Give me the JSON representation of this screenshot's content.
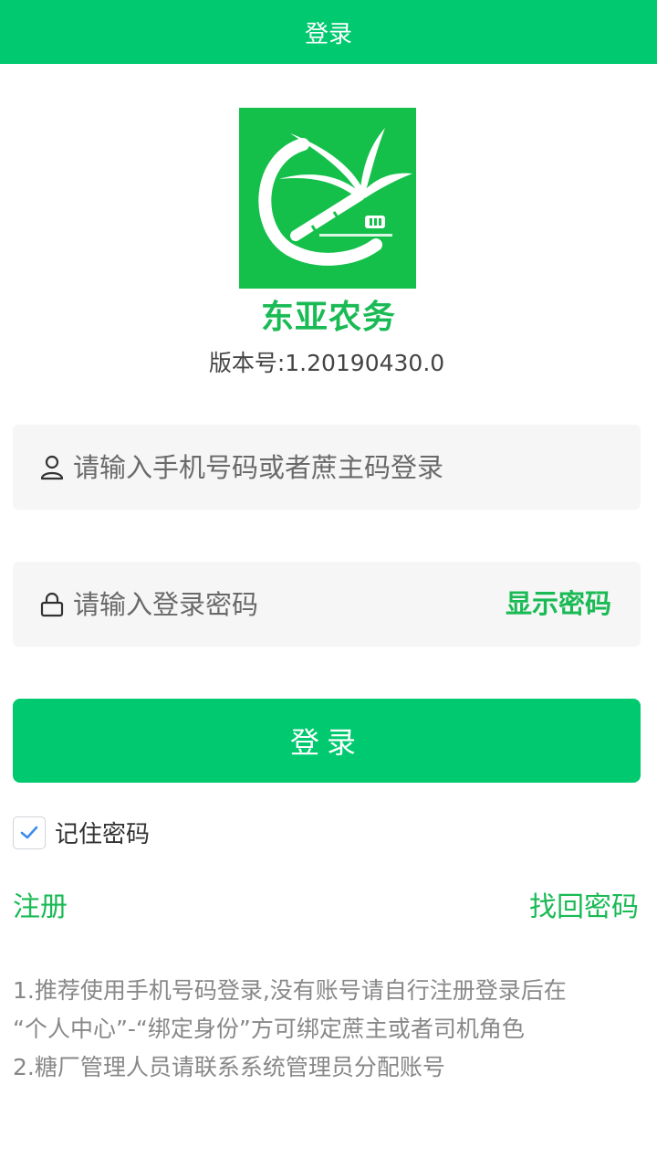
{
  "header": {
    "title": "登录"
  },
  "app": {
    "name": "东亚农务",
    "version": "版本号:1.20190430.0"
  },
  "form": {
    "account_placeholder": "请输入手机号码或者蔗主码登录",
    "password_placeholder": "请输入登录密码",
    "show_password_label": "显示密码",
    "login_label": "登录",
    "remember_label": "记住密码",
    "remember_checked": true
  },
  "links": {
    "register": "注册",
    "forgot_password": "找回密码"
  },
  "notes": [
    "1.推荐使用手机号码登录,没有账号请自行注册登录后在",
    "“个人中心”-“绑定身份”方可绑定蔗主或者司机角色",
    "2.糖厂管理人员请联系系统管理员分配账号"
  ],
  "colors": {
    "primary": "#00c96f",
    "accent_text": "#1aba55",
    "logo_bg": "#15c04a",
    "checkmark": "#3b8ce8"
  },
  "icons": {
    "account": "user-icon",
    "password": "lock-icon",
    "checkbox": "checkmark-icon"
  }
}
